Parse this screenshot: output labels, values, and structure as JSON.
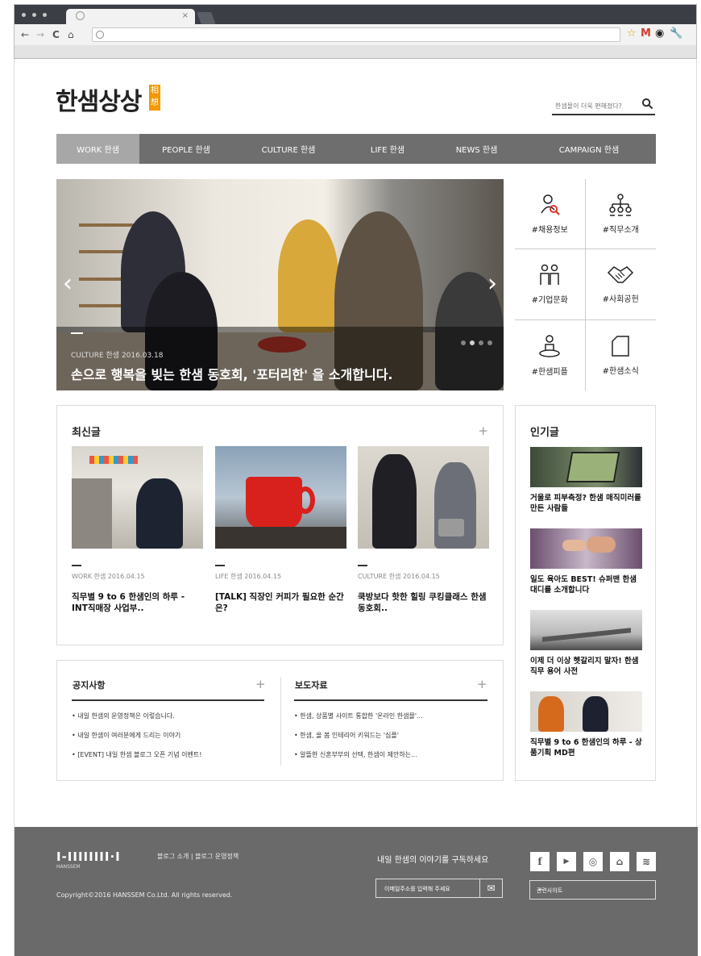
{
  "browser": {
    "tab_close": "×"
  },
  "header": {
    "logo_text": "한샘상상",
    "logo_stamp": "相想",
    "search_placeholder": "한샘몰이 더욱 편해졌다?"
  },
  "gnb": [
    {
      "label": "WORK 한샘",
      "active": true
    },
    {
      "label": "PEOPLE 한샘",
      "active": false
    },
    {
      "label": "CULTURE 한샘",
      "active": false
    },
    {
      "label": "LIFE 한샘",
      "active": false
    },
    {
      "label": "NEWS 한샘",
      "active": false
    },
    {
      "label": "CAMPAIGN 한샘",
      "active": false
    }
  ],
  "hero": {
    "meta": "CULTURE 한샘 2016.03.18",
    "title": "손으로 행복을 빚는 한샘 동호회, '포터리한' 을 소개합니다.",
    "prev": "‹",
    "next": "›",
    "slide_count": 4,
    "active_slide": 1
  },
  "quick_links": [
    {
      "label": "#채용정보",
      "icon": "recruit-icon"
    },
    {
      "label": "#직무소개",
      "icon": "org-chart-icon"
    },
    {
      "label": "#기업문화",
      "icon": "people-icon"
    },
    {
      "label": "#사회공헌",
      "icon": "handshake-icon"
    },
    {
      "label": "#한샘피플",
      "icon": "person-pin-icon"
    },
    {
      "label": "#한샘소식",
      "icon": "document-icon"
    }
  ],
  "latest": {
    "title": "최신글",
    "plus": "+",
    "cards": [
      {
        "meta": "WORK 한샘 2016.04.15",
        "title": "직무별 9 to 6 한샘인의 하루 - INT직매장 사업부.."
      },
      {
        "meta": "LIFE 한샘 2016.04.15",
        "title": "[TALK] 직장인 커피가 필요한 순간은?"
      },
      {
        "meta": "CULTURE 한샘 2016.04.15",
        "title": "쿡방보다 핫한 힐링 쿠킹클래스 한샘 동호회.."
      }
    ]
  },
  "notice": {
    "title": "공지사항",
    "plus": "+",
    "items": [
      "내일 한샘의 운영정책은 이렇습니다.",
      "내일 한샘이 여러분에게 드리는 이야기",
      "[EVENT] 내일 한샘 블로그 오픈 기념 이벤트!"
    ]
  },
  "press": {
    "title": "보도자료",
    "plus": "+",
    "items": [
      "한샘, 상품별 사이트 통합한 '온라인 한샘몰'...",
      "한샘, 올 봄 인테리어 키워드는 '심플'",
      "알뜰한 신혼부부의 선택, 한샘이 제안하는..."
    ]
  },
  "popular": {
    "title": "인기글",
    "items": [
      {
        "title": "거울로 피부측정? 한샘 매직미러를 만든 사람들"
      },
      {
        "title": "일도 육아도 BEST! 슈퍼맨 한샘 대디를 소개합니다"
      },
      {
        "title": "이제 더 이상 헷갈리지 말자! 한샘 직무 용어 사전"
      },
      {
        "title": "직무별 9 to 6 한샘인의 하루 - 상품기획 MD편"
      }
    ]
  },
  "footer": {
    "logo": "I-IIIIIIII·I",
    "logo_sub": "HANSSEM",
    "links": "블로그 소개  |  블로그 운영정책",
    "copyright": "Copyright©2016 HANSSEM Co.Ltd. All rights reserved.",
    "subscribe": "내일 한샘의 이야기를 구독하세요",
    "email_placeholder": "이메일주소를 입력해 주세요",
    "related_sites": "관련사이트",
    "sns": [
      "f",
      "▶",
      "◎",
      "⌂",
      "≋"
    ]
  }
}
